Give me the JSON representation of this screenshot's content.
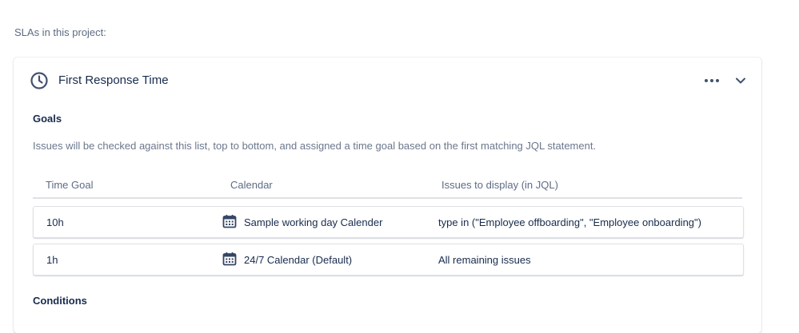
{
  "intro_text": "SLAs in this project:",
  "sla": {
    "title": "First Response Time",
    "icon": "clock-icon",
    "actions": {
      "more_icon": "more-horizontal-icon",
      "expand_icon": "chevron-down-icon"
    }
  },
  "goals": {
    "title": "Goals",
    "description": "Issues will be checked against this list, top to bottom, and assigned a time goal based on the first matching JQL statement.",
    "columns": {
      "time_goal": "Time Goal",
      "calendar": "Calendar",
      "jql": "Issues to display (in JQL)"
    },
    "rows": [
      {
        "time_goal": "10h",
        "calendar_icon": "calendar-icon",
        "calendar": "Sample working day Calender",
        "jql": "type in (\"Employee offboarding\", \"Employee onboarding\")"
      },
      {
        "time_goal": "1h",
        "calendar_icon": "calendar-icon",
        "calendar": "24/7 Calendar (Default)",
        "jql": "All remaining issues"
      }
    ]
  },
  "conditions": {
    "title": "Conditions"
  },
  "colors": {
    "text": "#172b4d",
    "subtle": "#5e6c84",
    "icon": "#42526e",
    "border": "#dfe1e6"
  }
}
